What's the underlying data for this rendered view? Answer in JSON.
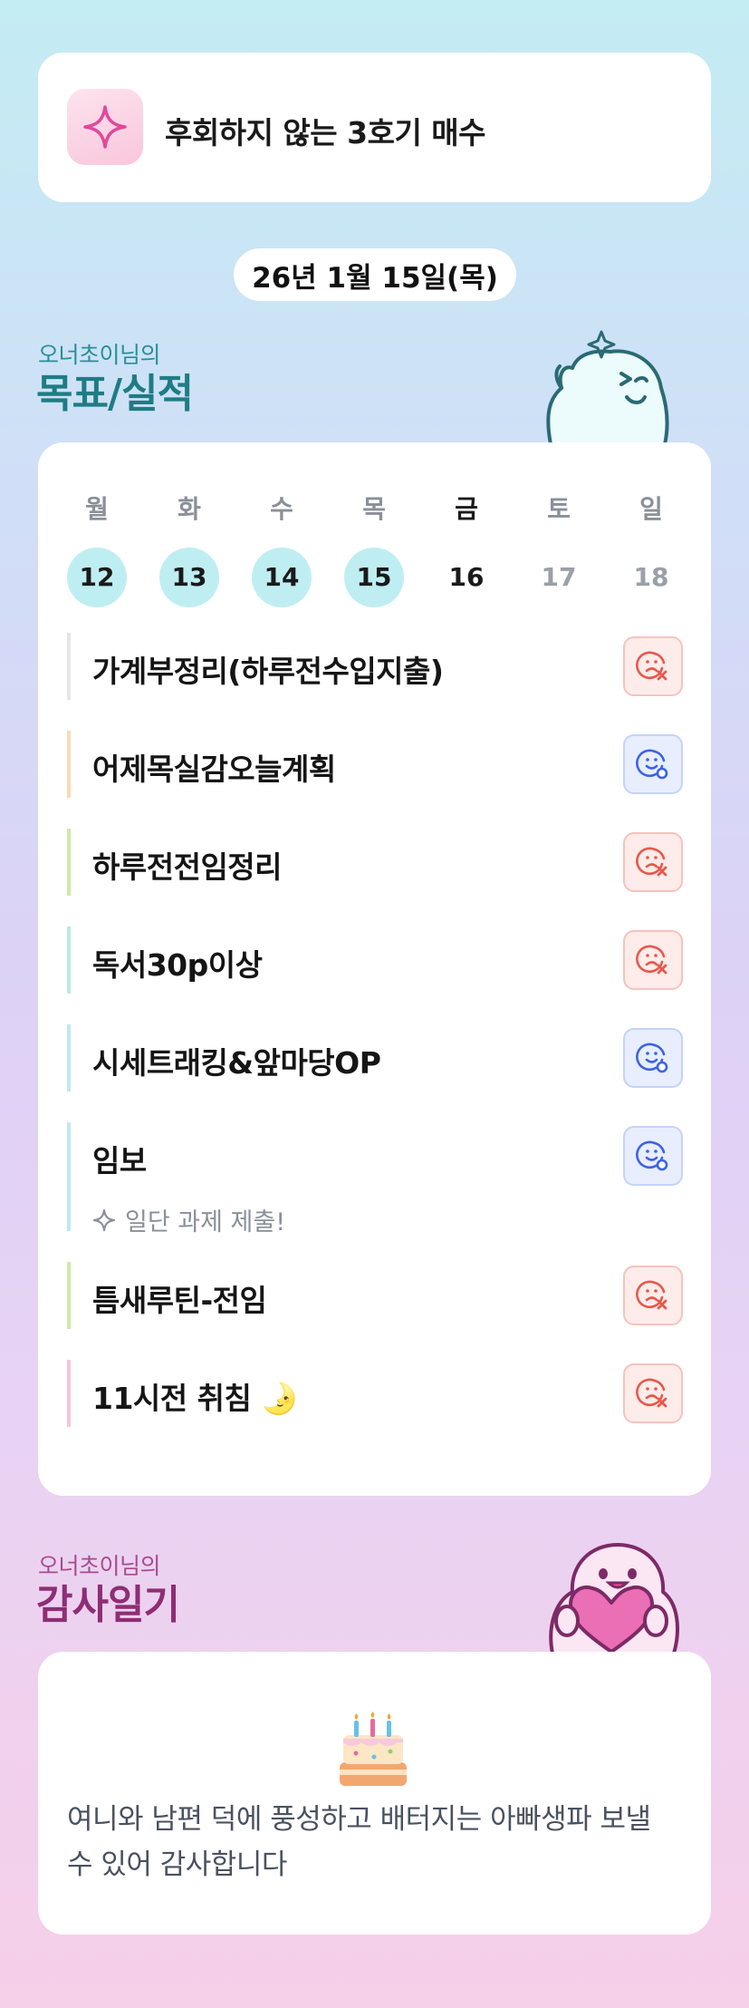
{
  "header": {
    "title": "후회하지 않는 3호기 매수",
    "icon": "sparkle-icon"
  },
  "date": "26년 1월 15일(목)",
  "goals_section": {
    "subtitle": "오너초이님의",
    "title": "목표/실적"
  },
  "week": {
    "days": [
      {
        "weekday": "월",
        "date": "12",
        "state": "done"
      },
      {
        "weekday": "화",
        "date": "13",
        "state": "done"
      },
      {
        "weekday": "수",
        "date": "14",
        "state": "done"
      },
      {
        "weekday": "목",
        "date": "15",
        "state": "done"
      },
      {
        "weekday": "금",
        "date": "16",
        "state": "today"
      },
      {
        "weekday": "토",
        "date": "17",
        "state": "future"
      },
      {
        "weekday": "일",
        "date": "18",
        "state": "future"
      }
    ]
  },
  "goals": [
    {
      "text": "가계부정리(하루전수입지출)",
      "status": "fail",
      "accent": "#e6e6e6"
    },
    {
      "text": "어제목실감오늘계획",
      "status": "ok",
      "accent": "#fbd9b4"
    },
    {
      "text": "하루전전임정리",
      "status": "fail",
      "accent": "#cfe9a8"
    },
    {
      "text": "독서30p이상",
      "status": "fail",
      "accent": "#b9ecdf"
    },
    {
      "text": "시세트래킹&앞마당OP",
      "status": "ok",
      "accent": "#bfe9f2"
    },
    {
      "text": "임보",
      "status": "ok",
      "accent": "#bfe9f2",
      "note": "일단 과제 제출!"
    },
    {
      "text": "틈새루틴-전임",
      "status": "fail",
      "accent": "#cfe9a8"
    },
    {
      "text": "11시전 취침 🌛",
      "status": "fail",
      "accent": "#f6c6dd"
    }
  ],
  "thanks_section": {
    "subtitle": "오너초이님의",
    "title": "감사일기"
  },
  "thanks": {
    "icon": "cake-icon",
    "text": "여니와 남편 덕에 풍성하고 배터지는 아빠생파 보낼 수 있어 감사합니다"
  },
  "colors": {
    "fail": "#e9574a",
    "ok": "#3c63e6",
    "done_circle": "#bfeef2"
  }
}
